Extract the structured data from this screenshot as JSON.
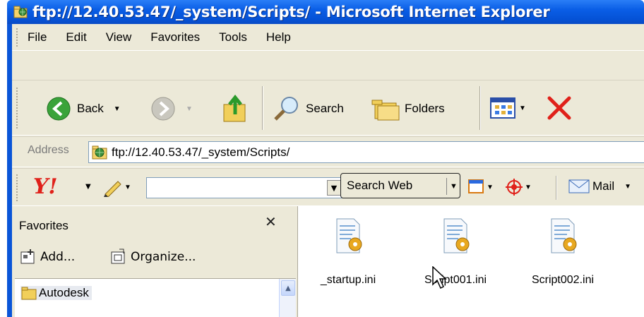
{
  "window": {
    "title": "ftp://12.40.53.47/_system/Scripts/ - Microsoft Internet Explorer"
  },
  "menu": {
    "items": [
      "File",
      "Edit",
      "View",
      "Favorites",
      "Tools",
      "Help"
    ]
  },
  "toolbar": {
    "back_label": "Back",
    "search_label": "Search",
    "folders_label": "Folders"
  },
  "address": {
    "label": "Address",
    "value": "ftp://12.40.53.47/_system/Scripts/"
  },
  "yahoo": {
    "search_button": "Search Web",
    "mail_label": "Mail",
    "search_value": ""
  },
  "favorites": {
    "title": "Favorites",
    "add_label": "Add...",
    "organize_label": "Organize...",
    "items": [
      "Autodesk"
    ]
  },
  "files": [
    {
      "name": "_startup.ini"
    },
    {
      "name": "Script001.ini"
    },
    {
      "name": "Script002.ini"
    }
  ],
  "colors": {
    "titlebar": "#0a5ee6",
    "chrome": "#ece9d8",
    "close_red": "#e0211a"
  }
}
